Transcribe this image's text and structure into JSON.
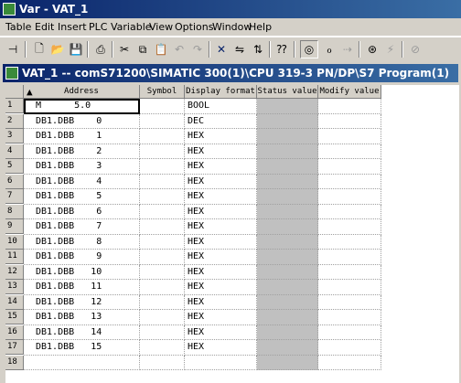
{
  "window": {
    "title": "Var - VAT_1"
  },
  "menu": [
    "Table",
    "Edit",
    "Insert",
    "PLC",
    "Variable",
    "View",
    "Options",
    "Window",
    "Help"
  ],
  "toolbar": {
    "buttons": [
      "pin-icon",
      "new-icon",
      "open-icon",
      "save-icon",
      "print-icon",
      "cut-icon",
      "copy-icon",
      "paste-icon",
      "undo-icon",
      "redo-icon",
      "delete-icon",
      "monitor-icon",
      "modify-icon",
      "help-context-icon",
      "monitor-variable-icon",
      "modify-variable-icon",
      "update-icon",
      "trigger-icon",
      "force-icon"
    ]
  },
  "child_window": {
    "title": "VAT_1 -- comS71200\\SIMATIC 300(1)\\CPU 319-3 PN/DP\\S7 Program(1)"
  },
  "table": {
    "columns": [
      "Address",
      "Symbol",
      "Display format",
      "Status value",
      "Modify value"
    ],
    "rows": [
      {
        "num": "1",
        "address": "M      5.0",
        "symbol": "",
        "format": "BOOL"
      },
      {
        "num": "2",
        "address": "DB1.DBB    0",
        "symbol": "",
        "format": "DEC"
      },
      {
        "num": "3",
        "address": "DB1.DBB    1",
        "symbol": "",
        "format": "HEX"
      },
      {
        "num": "4",
        "address": "DB1.DBB    2",
        "symbol": "",
        "format": "HEX"
      },
      {
        "num": "5",
        "address": "DB1.DBB    3",
        "symbol": "",
        "format": "HEX"
      },
      {
        "num": "6",
        "address": "DB1.DBB    4",
        "symbol": "",
        "format": "HEX"
      },
      {
        "num": "7",
        "address": "DB1.DBB    5",
        "symbol": "",
        "format": "HEX"
      },
      {
        "num": "8",
        "address": "DB1.DBB    6",
        "symbol": "",
        "format": "HEX"
      },
      {
        "num": "9",
        "address": "DB1.DBB    7",
        "symbol": "",
        "format": "HEX"
      },
      {
        "num": "10",
        "address": "DB1.DBB    8",
        "symbol": "",
        "format": "HEX"
      },
      {
        "num": "11",
        "address": "DB1.DBB    9",
        "symbol": "",
        "format": "HEX"
      },
      {
        "num": "12",
        "address": "DB1.DBB   10",
        "symbol": "",
        "format": "HEX"
      },
      {
        "num": "13",
        "address": "DB1.DBB   11",
        "symbol": "",
        "format": "HEX"
      },
      {
        "num": "14",
        "address": "DB1.DBB   12",
        "symbol": "",
        "format": "HEX"
      },
      {
        "num": "15",
        "address": "DB1.DBB   13",
        "symbol": "",
        "format": "HEX"
      },
      {
        "num": "16",
        "address": "DB1.DBB   14",
        "symbol": "",
        "format": "HEX"
      },
      {
        "num": "17",
        "address": "DB1.DBB   15",
        "symbol": "",
        "format": "HEX"
      },
      {
        "num": "18",
        "address": "",
        "symbol": "",
        "format": ""
      }
    ]
  }
}
